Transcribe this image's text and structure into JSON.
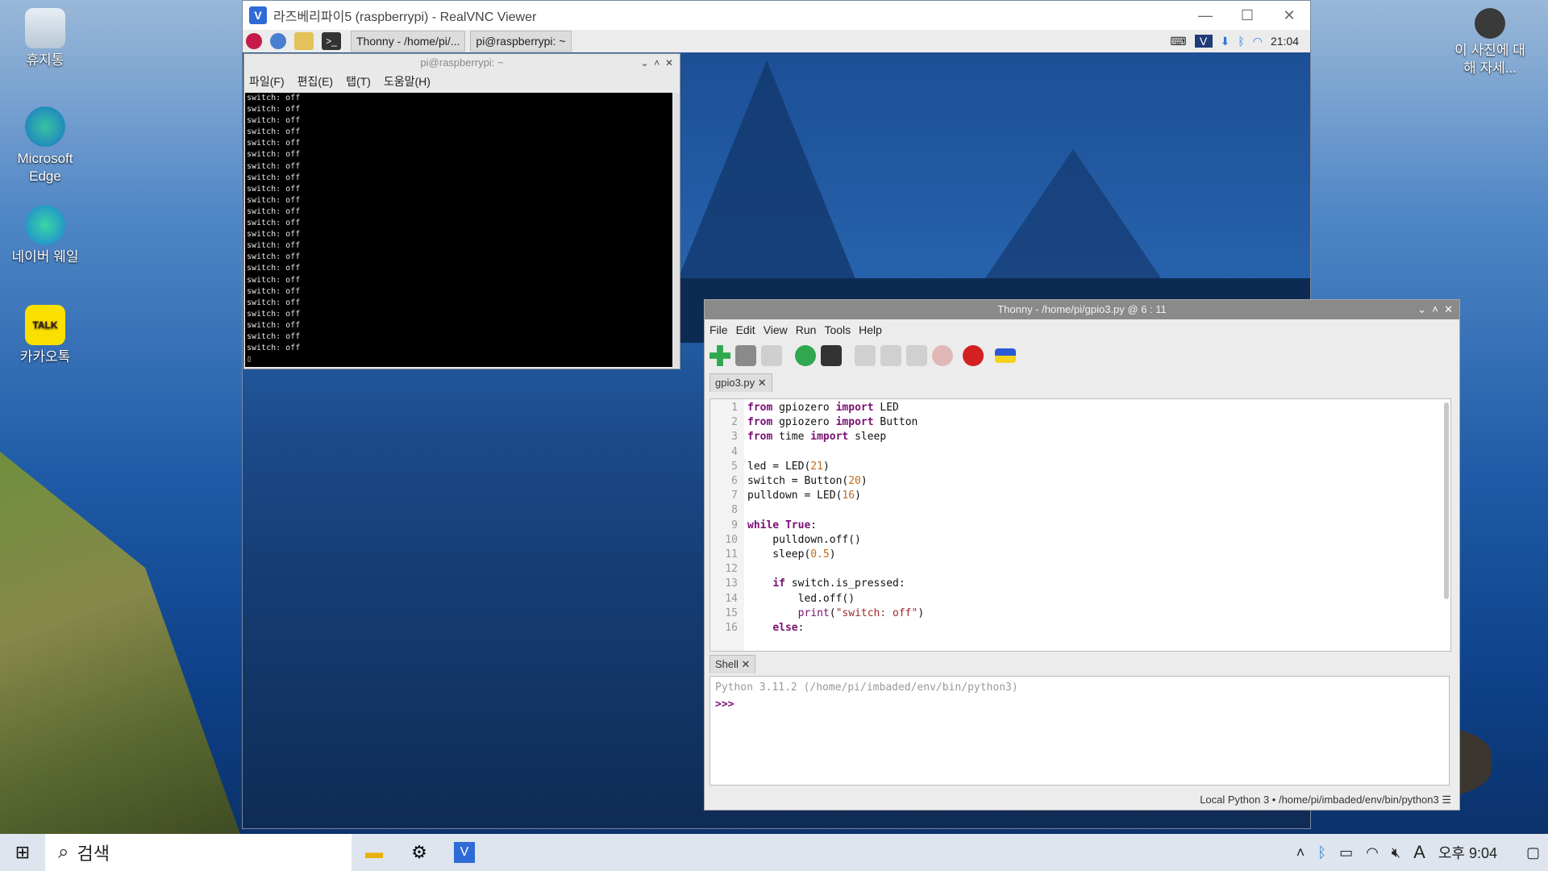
{
  "desktop": {
    "icons": [
      {
        "label": "휴지통"
      },
      {
        "label": "Microsoft Edge"
      },
      {
        "label": "네이버 웨일"
      },
      {
        "label": "카카오톡"
      }
    ],
    "about_photo": "이 사진에 대해 자세..."
  },
  "vnc": {
    "title": "라즈베리파이5 (raspberrypi) - RealVNC Viewer",
    "pi_taskbar": {
      "task_thonny": "Thonny  -  /home/pi/...",
      "task_terminal": "pi@raspberrypi: ~",
      "clock": "21:04"
    }
  },
  "terminal": {
    "title": "pi@raspberrypi: ~",
    "menu": [
      "파일(F)",
      "편집(E)",
      "탭(T)",
      "도움말(H)"
    ],
    "lines": [
      "switch: off",
      "switch: off",
      "switch: off",
      "switch: off",
      "switch: off",
      "switch: off",
      "switch: off",
      "switch: off",
      "switch: off",
      "switch: off",
      "switch: off",
      "switch: off",
      "switch: off",
      "switch: off",
      "switch: off",
      "switch: off",
      "switch: off",
      "switch: off",
      "switch: off",
      "switch: off",
      "switch: off",
      "switch: off",
      "switch: off"
    ]
  },
  "thonny": {
    "title": "Thonny  -  /home/pi/gpio3.py  @  6 : 11",
    "menu": [
      "File",
      "Edit",
      "View",
      "Run",
      "Tools",
      "Help"
    ],
    "editor_tab": "gpio3.py",
    "line_numbers": [
      "1",
      "2",
      "3",
      "4",
      "5",
      "6",
      "7",
      "8",
      "9",
      "10",
      "11",
      "12",
      "13",
      "14",
      "15",
      "16"
    ],
    "shell_tab": "Shell",
    "shell_version": "Python 3.11.2 (/home/pi/imbaded/env/bin/python3)",
    "shell_prompt": ">>>",
    "status": "Local Python 3  •  /home/pi/imbaded/env/bin/python3"
  },
  "win_taskbar": {
    "search_label": "검색",
    "time": "오후 9:04",
    "ime": "A"
  },
  "colors": {
    "keyword": "#7a0f73",
    "string": "#9a2a2a",
    "number": "#c16a1d",
    "run_green": "#2fa84f",
    "stop_red": "#d32020"
  }
}
